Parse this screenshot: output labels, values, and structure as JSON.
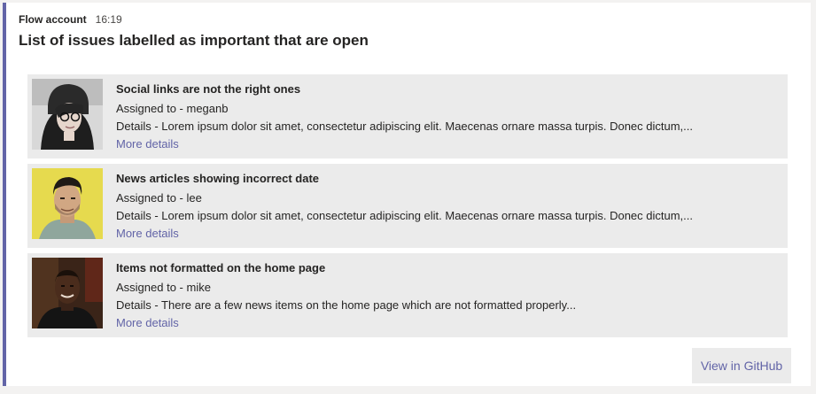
{
  "message": {
    "sender": "Flow account",
    "time": "16:19",
    "title": "List of issues labelled as important that are open"
  },
  "issues": [
    {
      "title": "Social links are not the right ones",
      "assigned": "Assigned to - meganb",
      "details": "Details - Lorem ipsum dolor sit amet, consectetur adipiscing elit. Maecenas ornare massa turpis. Donec dictum,...",
      "link": "More details"
    },
    {
      "title": "News articles showing incorrect date",
      "assigned": "Assigned to - lee",
      "details": "Details - Lorem ipsum dolor sit amet, consectetur adipiscing elit. Maecenas ornare massa turpis. Donec dictum,...",
      "link": "More details"
    },
    {
      "title": "Items not formatted on the home page",
      "assigned": "Assigned to - mike",
      "details": "Details - There are a few news items on the home page which are not formatted properly...",
      "link": "More details"
    }
  ],
  "actions": {
    "view_github": "View in GitHub"
  },
  "colors": {
    "accent": "#6264a7",
    "item_background": "#ebebeb",
    "card_background": "#ffffff"
  }
}
